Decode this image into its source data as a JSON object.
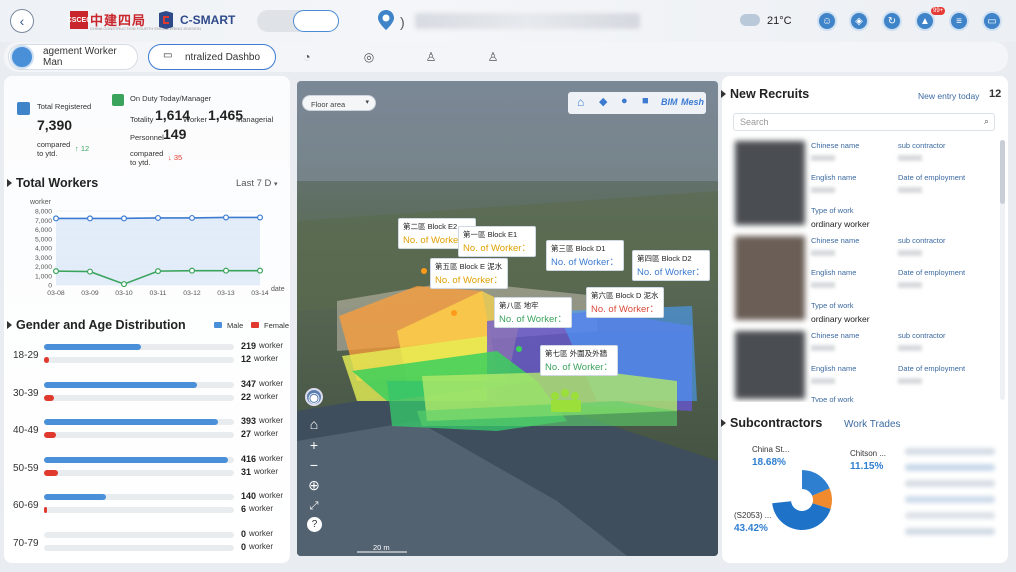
{
  "header": {
    "logo1_text": "中建四局",
    "logo1_badge": "CSCEC",
    "logo1_sub": "CHINA CONSTRUCTION FOURTH ENGINEERING DIVISION",
    "logo2_text": "C-SMART",
    "paren": ")",
    "temperature": "21°C",
    "badge": "99+",
    "icons": [
      "user-settings-icon",
      "compass-icon",
      "refresh-icon",
      "alert-icon",
      "document-icon",
      "device-icon"
    ]
  },
  "tabs": [
    {
      "label": "agement Worker Man",
      "icon": "user-icon",
      "active": false
    },
    {
      "label": "ntralized Dashbo",
      "icon": "monitor-icon",
      "active": true
    }
  ],
  "tab_icons": [
    "pie-chart-icon",
    "target-icon",
    "worker-icon",
    "person-key-icon"
  ],
  "stats": {
    "total_registered_label": "Total Registered",
    "total_registered_value": "7,390",
    "compared_label": "compared to ytd.",
    "total_registered_delta": "↑ 12",
    "on_duty_label": "On Duty Today/Manager",
    "totality_label": "Totality",
    "worker_value": "1,614",
    "worker_label": "Worker",
    "managerial_value": "1,465",
    "managerial_label": "Managerial",
    "personnel_label": "Personnel",
    "personnel_value": "149",
    "compared_label2": "compared to ytd.",
    "on_duty_delta": "↓ 35"
  },
  "total_workers": {
    "title": "Total Workers",
    "range": "Last 7 D",
    "ylabel": "worker",
    "xlabel": "date"
  },
  "chart_data": {
    "type": "line",
    "x": [
      "03-08",
      "03-09",
      "03-10",
      "03-11",
      "03-12",
      "03-13",
      "03-14"
    ],
    "y_ticks": [
      "8,000",
      "7,000",
      "6,000",
      "5,000",
      "4,000",
      "3,000",
      "2,000",
      "1,000",
      "0"
    ],
    "ylim": [
      0,
      8000
    ],
    "series": [
      {
        "values": [
          7200,
          7200,
          7200,
          7250,
          7250,
          7300,
          7300
        ],
        "color": "#3c7bd1"
      },
      {
        "values": [
          1500,
          1450,
          100,
          1500,
          1550,
          1550,
          1550
        ],
        "color": "#3aa35c"
      }
    ]
  },
  "gender_age": {
    "title": "Gender and Age Distribution",
    "legend_male": "Male",
    "legend_female": "Female",
    "male_color": "#4a90d9",
    "female_color": "#e0392e",
    "max": 430,
    "unit": "worker",
    "rows": [
      {
        "age": "18-29",
        "male": 219,
        "female": 12
      },
      {
        "age": "30-39",
        "male": 347,
        "female": 22
      },
      {
        "age": "40-49",
        "male": 393,
        "female": 27
      },
      {
        "age": "50-59",
        "male": 416,
        "female": 31
      },
      {
        "age": "60-69",
        "male": 140,
        "female": 6
      },
      {
        "age": "70-79",
        "male": 0,
        "female": 0
      }
    ]
  },
  "map": {
    "floor_select": "Floor area",
    "toolbar_icons": [
      "home-icon",
      "cube-icon",
      "pin-icon",
      "layers-icon"
    ],
    "bim_label": "BIM",
    "mesh_label": "Mesh",
    "scale": "20 m",
    "labels": [
      {
        "name": "第二區 Block E2",
        "value": "No. of Worker：",
        "style": "ml-orange"
      },
      {
        "name": "第一區 Block E1",
        "value": "No. of Worker：",
        "style": "ml-orange"
      },
      {
        "name": "第三區 Block D1",
        "value": "No. of Worker：",
        "style": "ml-blue"
      },
      {
        "name": "第四區 Block D2",
        "value": "No. of Worker：",
        "style": "ml-blue"
      },
      {
        "name": "第五區 Block E 泥水",
        "value": "No. of Worker：",
        "style": "ml-orange"
      },
      {
        "name": "第八區 地牢",
        "value": "No. of Worker：",
        "style": "ml-green"
      },
      {
        "name": "第六區 Block D 泥水",
        "value": "No. of Worker：",
        "style": "ml-red"
      },
      {
        "name": "第七區 外圍及外牆",
        "value": "No. of Worker：",
        "style": "ml-green"
      }
    ],
    "side_buttons": [
      "compass-icon",
      "home-icon",
      "zoom-in-icon",
      "zoom-out-icon",
      "globe-icon",
      "fullscreen-icon",
      "help-icon"
    ]
  },
  "recruits": {
    "title": "New Recruits",
    "entry_label": "New entry today",
    "entry_count": "12",
    "search_placeholder": "Search",
    "chinese_name_label": "Chinese name",
    "sub_contractor_label": "sub contractor",
    "english_name_label": "English name",
    "date_label": "Date of employment",
    "type_label": "Type of work",
    "cards": [
      {
        "type_value": "ordinary worker"
      },
      {
        "type_value": "ordinary worker"
      },
      {
        "type_value": ""
      }
    ]
  },
  "subcontractors": {
    "title": "Subcontractors",
    "tab2": "Work Trades",
    "slices": [
      {
        "name": "China St...",
        "pct": "18.68%",
        "value": 18.68,
        "color": "#2f7fd1"
      },
      {
        "name": "Chitson ...",
        "pct": "11.15%",
        "value": 11.15,
        "color": "#f08a2c"
      },
      {
        "name": "(S2053) ...",
        "pct": "43.42%",
        "value": 43.42,
        "color": "#1e73c8"
      }
    ]
  }
}
